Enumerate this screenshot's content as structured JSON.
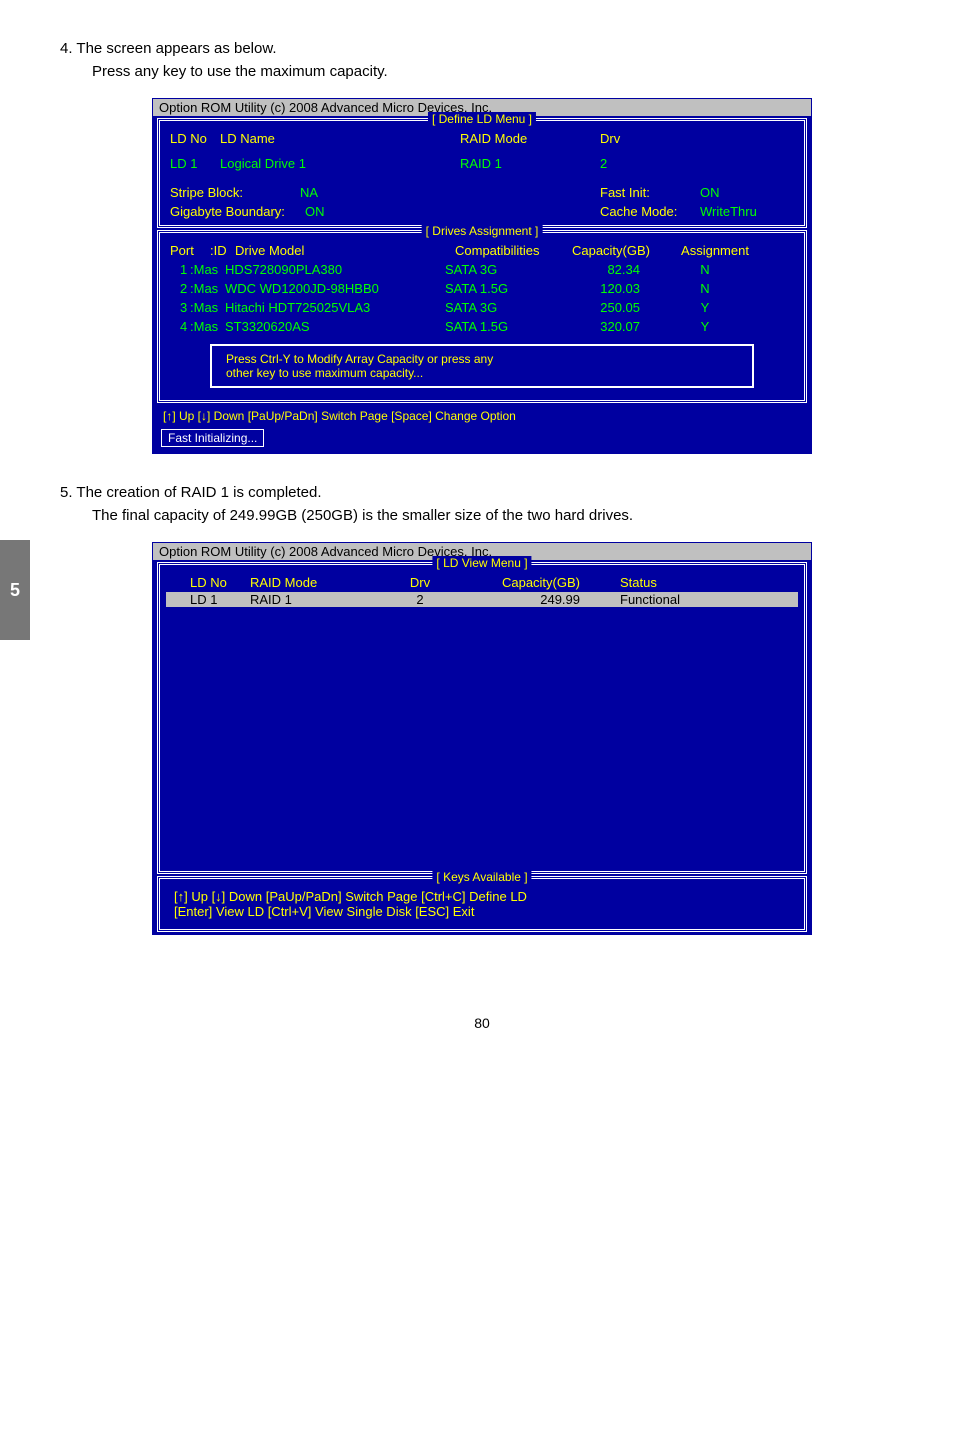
{
  "step4": {
    "title": "4. The screen appears as below.",
    "sub": "Press any key to use the maximum capacity."
  },
  "bios1": {
    "utility_title": "Option ROM Utility (c) 2008 Advanced Micro Devices, Inc.",
    "frame_label": "[ Define LD Menu ]",
    "header": {
      "ldno": "LD No",
      "ldname": "LD Name",
      "raidmode": "RAID Mode",
      "drv": "Drv"
    },
    "ld_row": {
      "ldno": "LD  1",
      "ldname": "Logical Drive 1",
      "raidmode": "RAID 1",
      "drv": "2"
    },
    "settings": {
      "stripe_block_label": "Stripe Block:",
      "stripe_block_val": "NA",
      "gigabyte_boundary_label": "Gigabyte Boundary:",
      "gigabyte_boundary_val": "ON",
      "fast_init_label": "Fast Init:",
      "fast_init_val": "ON",
      "cache_mode_label": "Cache Mode:",
      "cache_mode_val": "WriteThru"
    },
    "drives_frame_label": "[ Drives Assignment ]",
    "drives_header": {
      "port": "Port",
      "id": ":ID",
      "model": "Drive Model",
      "comp": "Compatibilities",
      "cap": "Capacity(GB)",
      "assign": "Assignment"
    },
    "drives": [
      {
        "port": "1",
        "id": ":Mas",
        "model": "HDS728090PLA380",
        "comp": "SATA  3G",
        "cap": "82.34",
        "assign": "N"
      },
      {
        "port": "2",
        "id": ":Mas",
        "model": "WDC WD1200JD-98HBB0",
        "comp": "SATA  1.5G",
        "cap": "120.03",
        "assign": "N"
      },
      {
        "port": "3",
        "id": ":Mas",
        "model": "Hitachi HDT725025VLA3",
        "comp": "SATA  3G",
        "cap": "250.05",
        "assign": "Y"
      },
      {
        "port": "4",
        "id": ":Mas",
        "model": "ST3320620AS",
        "comp": "SATA  1.5G",
        "cap": "320.07",
        "assign": "Y"
      }
    ],
    "prompt_line1": "Press Ctrl-Y to Modify Array Capacity or press any",
    "prompt_line2": "other key to use maximum capacity...",
    "footer_keys": "[↑] Up    [↓] Down    [PaUp/PaDn] Switch Page    [Space] Change Option",
    "fast_initializing": "Fast  Initializing..."
  },
  "step5": {
    "title": "5. The creation of RAID 1 is completed.",
    "sub": "The final capacity of 249.99GB (250GB) is the smaller size of the two hard drives."
  },
  "bios2": {
    "utility_title": "Option ROM Utility (c) 2008 Advanced Micro Devices, Inc.",
    "frame_label": "[ LD View Menu ]",
    "header": {
      "ldno": "LD No",
      "raidmode": "RAID Mode",
      "drv": "Drv",
      "cap": "Capacity(GB)",
      "status": "Status"
    },
    "row": {
      "ldno": "LD   1",
      "raidmode": "RAID 1",
      "drv": "2",
      "cap": "249.99",
      "status": "Functional"
    },
    "keys_frame_label": "[ Keys Available ]",
    "footer_line1": "[↑] Up    [↓] Down    [PaUp/PaDn] Switch Page    [Ctrl+C] Define LD",
    "footer_line2": "[Enter] View LD    [Ctrl+V] View Single Disk    [ESC] Exit"
  },
  "side_tab": "5",
  "page_number": "80"
}
